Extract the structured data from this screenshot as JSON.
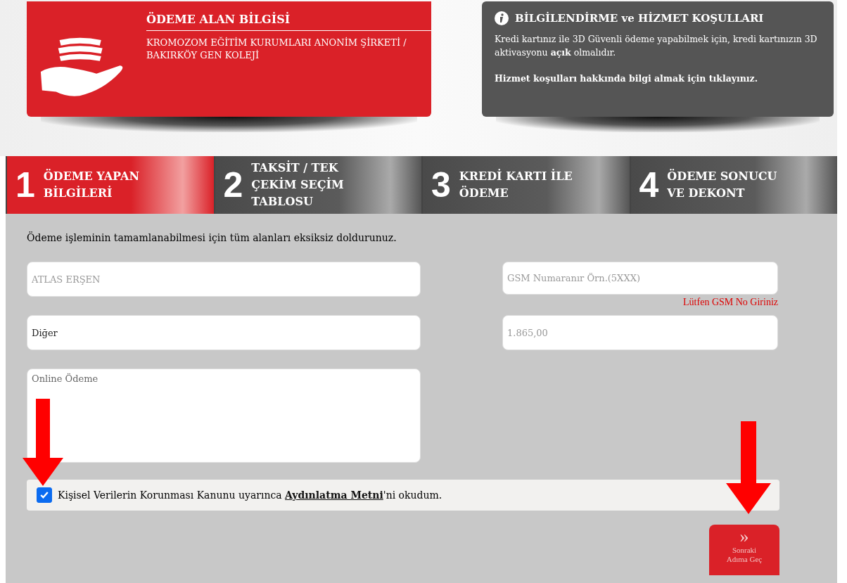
{
  "payee": {
    "title": "ÖDEME ALAN BİLGİSİ",
    "name": "KROMOZOM EĞİTİM KURUMLARI ANONİM ŞİRKETİ / BAKIRKÖY GEN KOLEJİ"
  },
  "info": {
    "title": "BİLGİLENDİRME ve HİZMET KOŞULLARI",
    "text": "Kredi kartınız ile 3D Güvenli ödeme yapabilmek için, kredi kartınızın 3D aktivasyonu **açık** olmalıdır.",
    "link": "Hizmet koşulları hakkında bilgi almak için tıklayınız."
  },
  "steps": [
    {
      "number": "1",
      "label": "ÖDEME YAPAN BİLGİLERİ",
      "selected": true
    },
    {
      "number": "2",
      "label": "TAKSİT / TEK ÇEKİM SEÇİM TABLOSU",
      "selected": false
    },
    {
      "number": "3",
      "label": "KREDİ KARTI İLE ÖDEME",
      "selected": false
    },
    {
      "number": "4",
      "label": "ÖDEME SONUCU VE DEKONT",
      "selected": false
    }
  ],
  "intro": "Ödeme işleminin tamamlanabilmesi için tüm alanları eksiksiz doldurunuz.",
  "fields": [
    {
      "placeholder": "ATLAS ERŞEN"
    },
    {
      "placeholder": "GSM Numaranır Örn.(5XXX)",
      "error": "Lütfen GSM No Giriniz"
    },
    {
      "value": "Diğer"
    },
    {
      "placeholder": "1.865,00"
    }
  ],
  "note": {
    "placeholder": "Online Ödeme"
  },
  "consent": {
    "checked": true,
    "before": "Kişisel Verilerin Korunması Kanunu uyarınca ",
    "link": "Aydınlatma Metni",
    "after": "'ni okudum."
  },
  "next_button": {
    "icon": "»",
    "label": "Sonraki Adıma Geç"
  }
}
